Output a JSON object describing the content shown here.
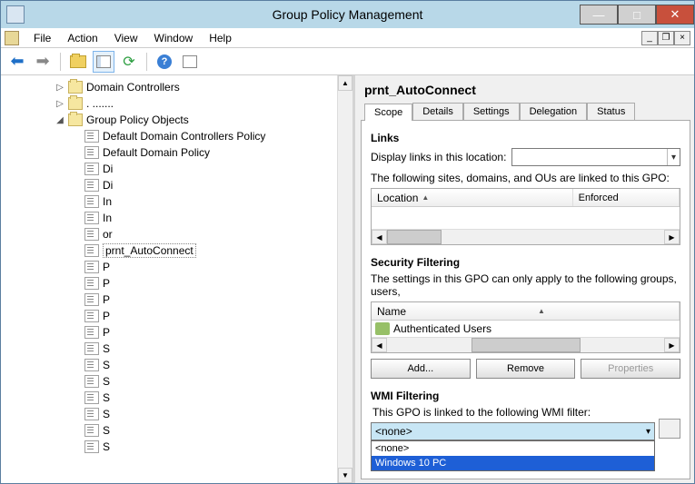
{
  "window": {
    "title": "Group Policy Management"
  },
  "menus": {
    "file": "File",
    "action": "Action",
    "view": "View",
    "window": "Window",
    "help": "Help"
  },
  "tree": {
    "domain_controllers": "Domain Controllers",
    "gpo_container": "Group Policy Objects",
    "items": [
      "Default Domain Controllers Policy",
      "Default Domain Policy",
      "Di",
      "Di",
      "In",
      "In",
      "or",
      "prnt_AutoConnect",
      "P",
      "P",
      "P",
      "P",
      "P",
      "S",
      "S",
      "S",
      "S",
      "S",
      "S",
      "S"
    ],
    "selected_index": 7
  },
  "gpo_title": "prnt_AutoConnect",
  "tabs": {
    "scope": "Scope",
    "details": "Details",
    "settings": "Settings",
    "delegation": "Delegation",
    "status": "Status"
  },
  "links": {
    "title": "Links",
    "display_label": "Display links in this location:",
    "list_desc": "The following sites, domains, and OUs are linked to this GPO:",
    "col_location": "Location",
    "col_enforced": "Enforced"
  },
  "security": {
    "title": "Security Filtering",
    "desc": "The settings in this GPO can only apply to the following groups, users,",
    "col_name": "Name",
    "entry": "Authenticated Users",
    "btn_add": "Add...",
    "btn_remove": "Remove",
    "btn_props": "Properties"
  },
  "wmi": {
    "title": "WMI Filtering",
    "desc": "This GPO is linked to the following WMI filter:",
    "selected": "<none>",
    "options": [
      "<none>",
      "Windows 10 PC"
    ]
  }
}
